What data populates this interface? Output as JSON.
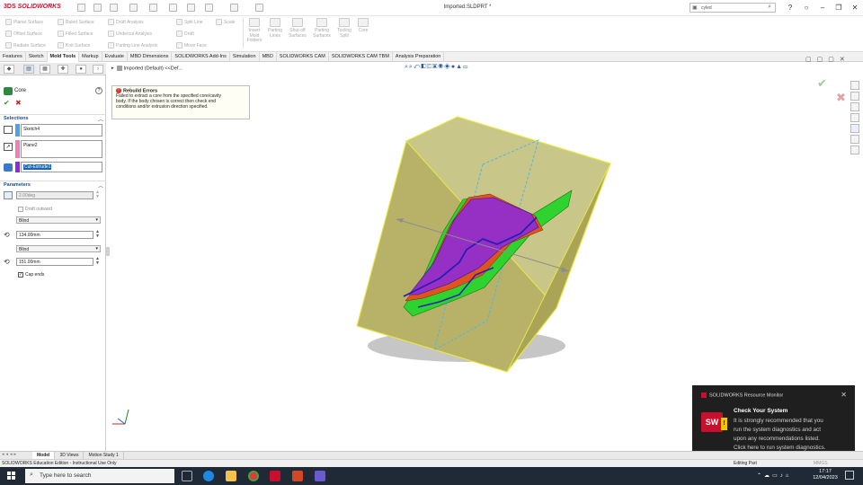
{
  "app": {
    "logo_text": "SOLIDWORKS",
    "document_title": "Imported.SLDPRT *"
  },
  "search": {
    "value": "cyled"
  },
  "ribbon": {
    "col1": [
      "Planar Surface",
      "Offset Surface",
      "Radiate Surface"
    ],
    "col2": [
      "Ruled Surface",
      "Filled Surface",
      "Knit Surface"
    ],
    "col3": [
      "Draft Analysis",
      "Undercut Analysis",
      "Parting Line Analysis"
    ],
    "col4": [
      "Split Line",
      "Draft",
      "Move Face"
    ],
    "col5": [
      "Scale"
    ],
    "big": [
      {
        "l1": "Insert",
        "l2": "Mold",
        "l3": "Folders"
      },
      {
        "l1": "Parting",
        "l2": "Lines",
        "l3": ""
      },
      {
        "l1": "Shut-off",
        "l2": "Surfaces",
        "l3": ""
      },
      {
        "l1": "Parting",
        "l2": "Surfaces",
        "l3": ""
      },
      {
        "l1": "Tooling",
        "l2": "Split",
        "l3": ""
      },
      {
        "l1": "Core",
        "l2": "",
        "l3": ""
      }
    ]
  },
  "tabs": [
    "Features",
    "Sketch",
    "Mold Tools",
    "Markup",
    "Evaluate",
    "MBD Dimensions",
    "SOLIDWORKS Add-Ins",
    "Simulation",
    "MBD",
    "SOLIDWORKS CAM",
    "SOLIDWORKS CAM TBM",
    "Analysis Preparation"
  ],
  "panel": {
    "title": "Core",
    "help": "?",
    "ok": "✔",
    "cancel": "✖",
    "selections_header": "Selections",
    "sel1": "Sketch4",
    "sel2": "Plane2",
    "sel3": "Cut-Extrude1",
    "parameters_header": "Parameters",
    "draft_angle": "2.00deg",
    "draft_outward": "Draft outward",
    "dir1_type": "Blind",
    "dir1_depth": "134.00mm",
    "dir2_type": "Blind",
    "dir2_depth": "151.00mm",
    "cap_ends": "Cap ends"
  },
  "tree": {
    "root": "Imported (Default) <<Def..."
  },
  "rebuild": {
    "title": "Rebuild Errors",
    "line1": "Failed to extract a core from the specified core/cavity",
    "line2": "body. If the body chosen is correct then check end",
    "line3": "conditions and/or extrusion direction specified."
  },
  "notification": {
    "header": "SOLIDWORKS Resource Monitor",
    "title": "Check Your System",
    "body1": "It is strongly recommended that you",
    "body2": "run the system diagnostics and act",
    "body3": "upon any recommendations listed.",
    "body4": "Click here to run system diagnostics."
  },
  "bottom_tabs": [
    "Model",
    "3D Views",
    "Motion Study 1"
  ],
  "status": {
    "left": "SOLIDWORKS Education Edition - Instructional Use Only",
    "mode": "Editing Part",
    "units": "MMGS"
  },
  "taskbar": {
    "search_placeholder": "Type here to search",
    "time": "17:17",
    "date": "12/04/2023"
  },
  "colors": {
    "accent": "#c8102e",
    "box_fill": "#b6b25a",
    "box_edge": "#e8e840",
    "part_green": "#2fd32f",
    "part_purple": "#8a2be2"
  }
}
